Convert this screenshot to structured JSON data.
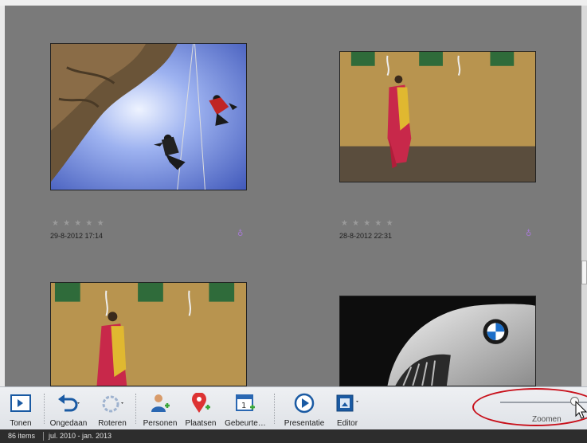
{
  "photos": [
    {
      "stars": "★ ★ ★ ★ ★",
      "date": "29-8-2012 17:14",
      "subject": "climbers"
    },
    {
      "stars": "★ ★ ★ ★ ★",
      "date": "28-8-2012 22:31",
      "subject": "woman-wall"
    },
    {
      "stars": "",
      "date": "",
      "subject": "woman-wall-2"
    },
    {
      "stars": "",
      "date": "",
      "subject": "bmw-car"
    }
  ],
  "tag_symbol": "♁",
  "toolbar": {
    "items": [
      {
        "label": "Tonen",
        "icon": "show-panel-icon"
      },
      {
        "label": "Ongedaan",
        "icon": "undo-icon"
      },
      {
        "label": "Roteren",
        "icon": "rotate-icon"
      },
      {
        "label": "Personen",
        "icon": "people-icon"
      },
      {
        "label": "Plaatsen",
        "icon": "location-pin-icon"
      },
      {
        "label": "Gebeurte…",
        "icon": "calendar-icon"
      },
      {
        "label": "Presentatie",
        "icon": "play-icon"
      },
      {
        "label": "Editor",
        "icon": "editor-icon"
      }
    ],
    "zoom_label": "Zoomen",
    "zoom_level": 0.82
  },
  "status": {
    "count": "86 items",
    "range": "jul. 2010 - jan. 2013"
  },
  "colors": {
    "accent": "#1a5aa3",
    "highlight": "#c8101b",
    "pin": "#d33"
  }
}
